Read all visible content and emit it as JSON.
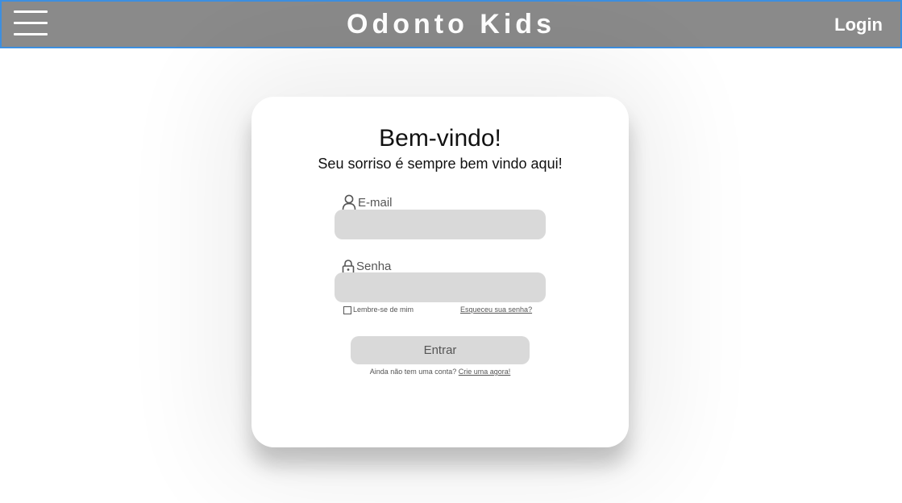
{
  "header": {
    "title": "Odonto Kids",
    "login_label": "Login"
  },
  "login_card": {
    "heading": "Bem-vindo!",
    "subtitle": "Seu sorriso é sempre bem vindo aqui!",
    "email_label": "E-mail",
    "email_value": "",
    "password_label": "Senha",
    "password_value": "",
    "remember_label": "Lembre-se de mim",
    "remember_checked": false,
    "forgot_label": "Esqueceu sua senha?",
    "submit_label": "Entrar",
    "signup_prompt": "Ainda não tem uma conta?",
    "signup_link": "Crie uma agora!"
  },
  "icons": {
    "menu": "hamburger-menu-icon",
    "email": "user-icon",
    "password": "lock-icon"
  },
  "colors": {
    "header_bg": "#8a8a8a",
    "header_border": "#3d8fe0",
    "input_bg": "#d9d9d9",
    "card_bg": "#ffffff"
  }
}
